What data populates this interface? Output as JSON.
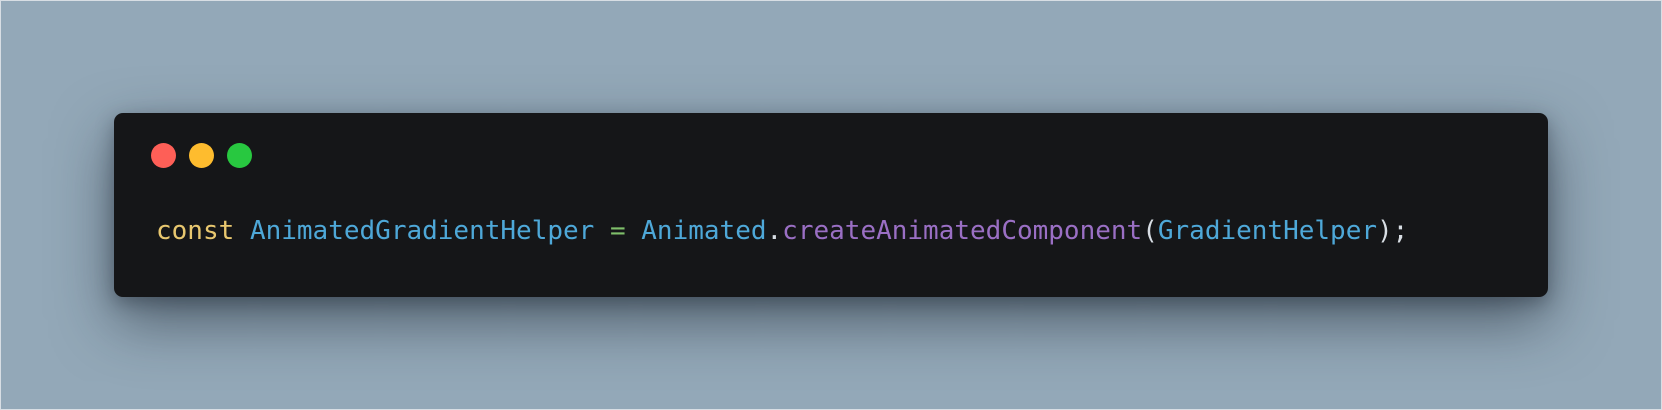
{
  "window": {
    "traffic_lights": [
      {
        "name": "close",
        "color": "#fe5f57"
      },
      {
        "name": "minimize",
        "color": "#febc2e"
      },
      {
        "name": "zoom",
        "color": "#28c840"
      }
    ]
  },
  "code": {
    "language": "javascript",
    "tokens": {
      "keyword": "const",
      "space1": " ",
      "variable": "AnimatedGradientHelper",
      "space2": " ",
      "operator": "=",
      "space3": " ",
      "object": "Animated",
      "dot": ".",
      "method": "createAnimatedComponent",
      "open_paren": "(",
      "argument": "GradientHelper",
      "close_paren": ")",
      "semicolon": ";"
    }
  },
  "colors": {
    "background": "#93a8b8",
    "window_background": "#151618",
    "keyword": "#e8c76f",
    "identifier": "#4ea8d8",
    "operator": "#7fbf6a",
    "method": "#9a6fc4",
    "punctuation": "#d8dee4"
  }
}
